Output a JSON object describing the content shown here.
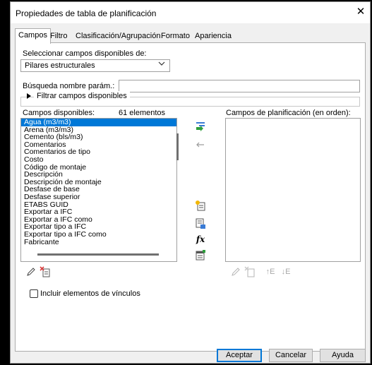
{
  "window": {
    "title": "Propiedades de tabla de planificación",
    "close_glyph": "✕"
  },
  "tabs": [
    {
      "label": "Campos",
      "active": true
    },
    {
      "label": "Filtro"
    },
    {
      "label": "Clasificación/Agrupación"
    },
    {
      "label": "Formato"
    },
    {
      "label": "Apariencia"
    }
  ],
  "fields": {
    "source_label": "Seleccionar campos disponibles de:",
    "source_value": "Pilares estructurales",
    "search_label": "Búsqueda nombre parám.:",
    "search_value": "",
    "filter_toggle": "Filtrar campos disponibles",
    "available_label": "Campos disponibles:",
    "available_count": "61 elementos",
    "schedule_label": "Campos de planificación (en orden):",
    "available_items": [
      "Agua (m3/m3)",
      "Arena (m3/m3)",
      "Cemento (bls/m3)",
      "Comentarios",
      "Comentarios de tipo",
      "Costo",
      "Código de montaje",
      "Descripción",
      "Descripción de montaje",
      "Desfase de base",
      "Desfase superior",
      "ETABS GUID",
      "Exportar a IFC",
      "Exportar a IFC como",
      "Exportar tipo a IFC",
      "Exportar tipo a IFC como",
      "Fabricante"
    ],
    "selected_index": 0,
    "include_links_label": "Incluir elementos de vínculos",
    "include_links_checked": false
  },
  "buttons": {
    "ok": "Aceptar",
    "cancel": "Cancelar",
    "help": "Ayuda"
  },
  "icons": {
    "add": "add-parameter-icon",
    "remove": "remove-parameter-icon",
    "new_param": "new-parameter-icon",
    "combine": "combine-parameters-icon",
    "fx": "fx",
    "calc": "calculated-value-icon",
    "edit": "edit-icon",
    "delete": "delete-icon",
    "move_up": "↑E",
    "move_down": "↓E"
  },
  "colors": {
    "selection": "#0078d7",
    "accent_green": "#2e9e3c",
    "accent_red": "#d83b3b"
  }
}
